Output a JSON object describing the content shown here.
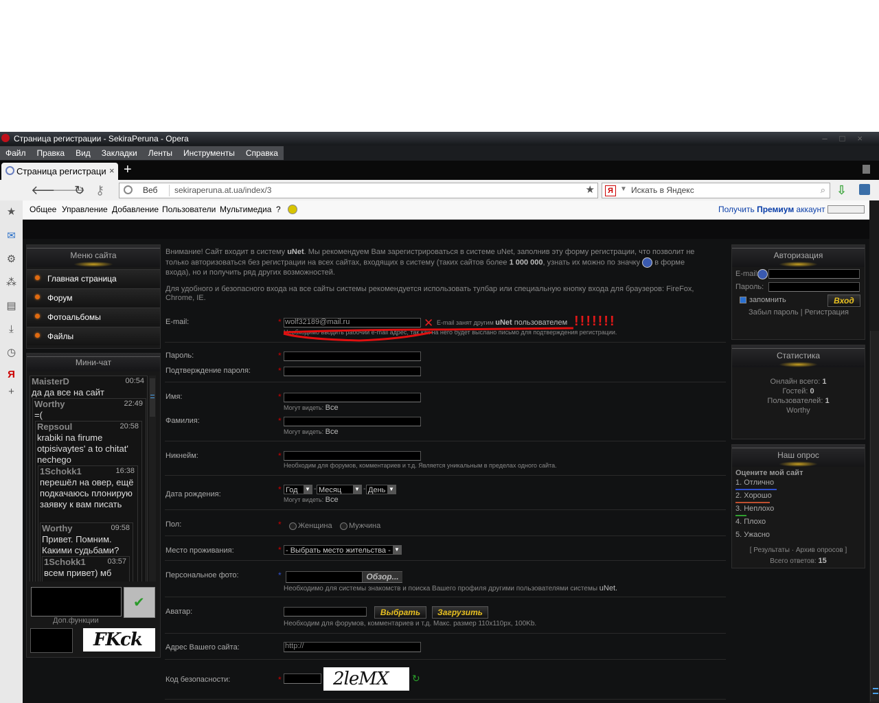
{
  "window": {
    "title": "Страница регистрации - SekiraPeruna - Opera"
  },
  "menubar": [
    "Файл",
    "Правка",
    "Вид",
    "Закладки",
    "Ленты",
    "Инструменты",
    "Справка"
  ],
  "tab": {
    "label": "Страница регистрации ...",
    "close": "×",
    "new": "+"
  },
  "address": {
    "scheme_label": "Веб",
    "url": "sekiraperuna.at.ua/index/3",
    "search_placeholder": "Искать в Яндекс"
  },
  "ucoz_panel": {
    "items": [
      "Общее",
      "Управление",
      "Добавление",
      "Пользователи",
      "Мультимедиа",
      "?"
    ],
    "premium_prefix": "Получить ",
    "premium_bold": "Премиум",
    "premium_suffix": " аккаунт"
  },
  "site_menu": {
    "title": "Меню сайта",
    "items": [
      "Главная страница",
      "Форум",
      "Фотоальбомы",
      "Файлы"
    ]
  },
  "minichat": {
    "title": "Мини-чат",
    "messages": [
      {
        "user": "MaisterD",
        "time": "00:54",
        "text": "да да все на сайт"
      },
      {
        "user": "Worthy",
        "time": "22:49",
        "text": "=("
      },
      {
        "user": "Repsoul",
        "time": "20:58",
        "text": "krabiki na firume otpisivaytes' a to chitat' nechego"
      },
      {
        "user": "1Schokk1",
        "time": "16:38",
        "text": "перешёл на овер, ещё подкачаюсь плонирую заявку к вам писать"
      },
      {
        "user": "Worthy",
        "time": "09:58",
        "text": "Привет. Помним. Какими судьбами?"
      },
      {
        "user": "1Schokk1",
        "time": "03:57",
        "text": "всем привет) мб кто"
      }
    ],
    "extra_label": "Доп.функции",
    "captcha_text": "FKck"
  },
  "notice": {
    "p1_a": "Внимание! Сайт входит в систему ",
    "p1_b": "uNet",
    "p1_c": ". Мы рекомендуем Вам зарегистрироваться в системе uNet, заполнив эту форму регистрации, что позволит не только авторизоваться без регистрации на всех сайтах, входящих в систему (таких сайтов более ",
    "p1_d": "1 000 000",
    "p1_e": ", узнать их можно по значку",
    "p1_f": "в форме входа), но и получить ряд других возможностей.",
    "p2": "Для удобного и безопасного входа на все сайты системы рекомендуется использовать тулбар или специальную кнопку входа для браузеров: FireFox, Chrome, IE."
  },
  "form": {
    "email_label": "E-mail:",
    "email_value": "wolf32189@mail.ru",
    "email_error_a": "E-mail занят другим ",
    "email_error_b": "uNet",
    "email_error_c": " пользователем",
    "email_exclaim": "!!!!!!!",
    "email_hint": "Необходимо вводить рабочий e-mail адрес, так как на него будет выслано письмо для подтверждения регистрации.",
    "password_label": "Пароль:",
    "password_confirm_label": "Подтверждение пароля:",
    "name_label": "Имя:",
    "surname_label": "Фамилия:",
    "visible_prefix": "Могут видеть:",
    "visible_value": "Все",
    "nickname_label": "Никнейм:",
    "nickname_hint": "Необходим для форумов, комментариев и т.д. Является уникальным в пределах одного сайта.",
    "birth_label": "Дата рождения:",
    "birth_year": "Год",
    "birth_month": "Месяц",
    "birth_day": "День",
    "gender_label": "Пол:",
    "gender_female": "Женщина",
    "gender_male": "Мужчина",
    "residence_label": "Место проживания:",
    "residence_value": "- Выбрать место жительства -",
    "photo_label": "Персональное фото:",
    "photo_button": "Обзор...",
    "photo_hint_a": "Необходимо для системы знакомств и поиска Вашего профиля другими пользователями системы ",
    "photo_hint_b": "uNet.",
    "avatar_label": "Аватар:",
    "avatar_choose": "Выбрать",
    "avatar_upload": "Загрузить",
    "avatar_hint": "Необходим для форумов, комментариев и т.д. Макс. размер 110x110px, 100Kb.",
    "site_label": "Адрес Вашего сайта:",
    "site_value": "http://",
    "captcha_label": "Код безопасности:",
    "captcha_text": "2leMX"
  },
  "auth": {
    "title": "Авторизация",
    "email_label": "E-mail:",
    "password_label": "Пароль:",
    "remember_label": "запомнить",
    "login_button": "Вход",
    "forgot": "Забыл пароль",
    "divider": "|",
    "register": "Регистрация"
  },
  "stats": {
    "title": "Статистика",
    "online_label": "Онлайн всего:",
    "online_value": "1",
    "guests_label": "Гостей:",
    "guests_value": "0",
    "users_label": "Пользователей:",
    "users_value": "1",
    "user_name": "Worthy"
  },
  "poll": {
    "title": "Наш опрос",
    "question": "Оцените мой сайт",
    "options": [
      {
        "label": "1. Отлично",
        "share": 1.0,
        "color": "#3050d0"
      },
      {
        "label": "2. Хорошо",
        "share": 0.83,
        "color": "#c05030"
      },
      {
        "label": "3. Неплохо",
        "share": 0.27,
        "color": "#30a030"
      },
      {
        "label": "4. Плохо",
        "share": 0,
        "color": "#888888"
      },
      {
        "label": "5. Ужасно",
        "share": 0,
        "color": "#888888"
      }
    ],
    "results": "Результаты",
    "archive": "Архив опросов",
    "total_label": "Всего ответов:",
    "total_value": "15"
  },
  "colors": {
    "accent_red": "#cc0000",
    "button_yellow": "#e8c020",
    "link_blue": "#0a3ea8"
  }
}
